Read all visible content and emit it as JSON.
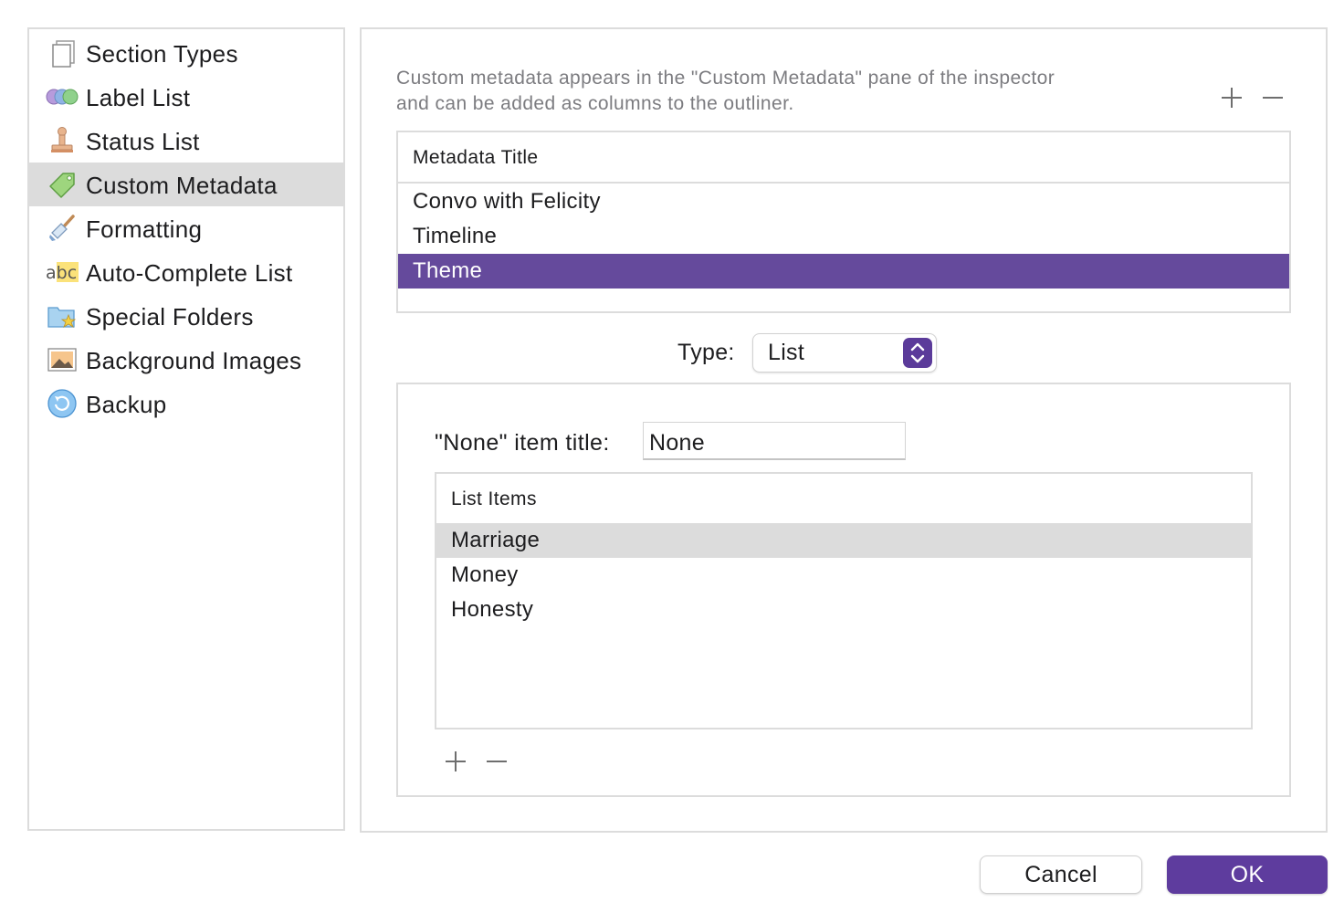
{
  "sidebar": {
    "items": [
      {
        "label": "Section Types",
        "icon": "page-icon"
      },
      {
        "label": "Label List",
        "icon": "label-circles-icon"
      },
      {
        "label": "Status List",
        "icon": "stamp-icon"
      },
      {
        "label": "Custom Metadata",
        "icon": "tag-icon",
        "selected": true
      },
      {
        "label": "Formatting",
        "icon": "paintbrush-icon"
      },
      {
        "label": "Auto-Complete List",
        "icon": "abc-icon"
      },
      {
        "label": "Special Folders",
        "icon": "star-folder-icon"
      },
      {
        "label": "Background Images",
        "icon": "image-icon"
      },
      {
        "label": "Backup",
        "icon": "backup-icon"
      }
    ]
  },
  "main": {
    "description_line1": "Custom metadata appears in the \"Custom Metadata\" pane of the inspector",
    "description_line2": "and can be added as columns to the outliner.",
    "metadata_table": {
      "header": "Metadata Title",
      "rows": [
        "Convo with Felicity",
        "Timeline",
        "Theme"
      ],
      "selected_index": 2
    },
    "type_label": "Type:",
    "type_value": "List",
    "none_item_label": "\"None\" item title:",
    "none_item_value": "None",
    "list_items_table": {
      "header": "List Items",
      "rows": [
        "Marriage",
        "Money",
        "Honesty"
      ],
      "highlighted_index": 0
    }
  },
  "buttons": {
    "cancel": "Cancel",
    "ok": "OK"
  },
  "colors": {
    "accent": "#5e3c9e",
    "selection": "#654a9c",
    "sidebar_selection": "#dcdcdc"
  }
}
